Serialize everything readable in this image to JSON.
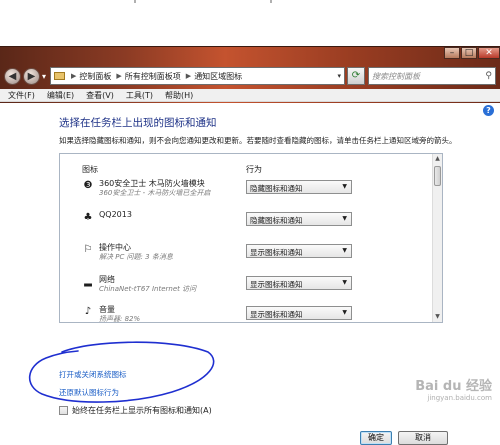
{
  "window": {
    "breadcrumbs": [
      "控制面板",
      "所有控制面板项",
      "通知区域图标"
    ],
    "search_placeholder": "搜索控制面板"
  },
  "menu": [
    "文件(F)",
    "编辑(E)",
    "查看(V)",
    "工具(T)",
    "帮助(H)"
  ],
  "page": {
    "title": "选择在任务栏上出现的图标和通知",
    "description": "如果选择隐藏图标和通知，则不会向您通知更改和更新。若要随时查看隐藏的图标，请单击任务栏上通知区域旁的箭头。",
    "col_icon": "图标",
    "col_behavior": "行为",
    "rows": [
      {
        "name": "360安全卫士 木马防火墙模块",
        "desc": "360安全卫士 - 木马防火墙已全开启",
        "behavior": "隐藏图标和通知",
        "icon": "shield-icon",
        "glyph": "❸"
      },
      {
        "name": "QQ2013",
        "desc": "",
        "behavior": "隐藏图标和通知",
        "icon": "qq-penguin-icon",
        "glyph": "♣"
      },
      {
        "name": "操作中心",
        "desc": "解决 PC 问题: 3 条消息",
        "behavior": "显示图标和通知",
        "icon": "flag-icon",
        "glyph": "⚐"
      },
      {
        "name": "网络",
        "desc": "ChinaNet-tT67 Internet 访问",
        "behavior": "显示图标和通知",
        "icon": "network-signal-icon",
        "glyph": "▂"
      },
      {
        "name": "音量",
        "desc": "扬声器: 82%",
        "behavior": "显示图标和通知",
        "icon": "speaker-icon",
        "glyph": "♪"
      }
    ],
    "link_system_icons": "打开或关闭系统图标",
    "link_restore": "还原默认图标行为",
    "checkbox_label": "始终在任务栏上显示所有图标和通知(A)",
    "checkbox_checked": false,
    "ok": "确定",
    "cancel": "取消"
  },
  "watermark": {
    "text": "Bai du 经验",
    "sub": "jingyan.baidu.com"
  },
  "colors": {
    "title": "#1e3287",
    "link": "#1b5ec6",
    "annotation": "#1f2fd0"
  }
}
